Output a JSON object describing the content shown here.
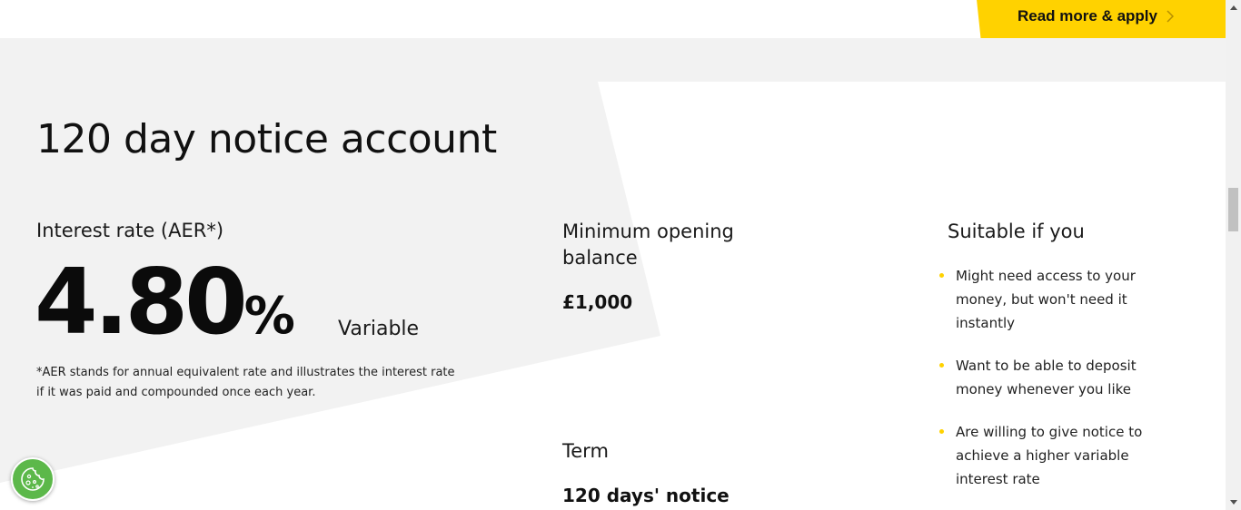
{
  "cta": {
    "label": "Read more & apply",
    "accent_color": "#ffd200"
  },
  "product": {
    "title": "120 day notice account",
    "interest_rate_label": "Interest rate (AER*)",
    "rate_value": "4.80",
    "rate_percent": "%",
    "rate_type": "Variable",
    "aer_note": "*AER stands for annual equivalent rate and illustrates the interest rate if it was paid and compounded once each year."
  },
  "minimum_balance": {
    "heading": "Minimum opening balance",
    "value": "£1,000"
  },
  "term": {
    "heading": "Term",
    "value": "120 days' notice"
  },
  "suitable": {
    "heading": "Suitable if you",
    "items": [
      "Might need access to your money, but won't need it instantly",
      "Want to be able to deposit money whenever you like",
      "Are willing to give notice to achieve a higher variable interest rate"
    ],
    "bullet_color": "#ffd200"
  },
  "cookie": {
    "icon": "cookie-icon",
    "color": "#5cb84a"
  },
  "colors": {
    "section_background": "#f2f2f2",
    "panel_background": "#ffffff"
  }
}
